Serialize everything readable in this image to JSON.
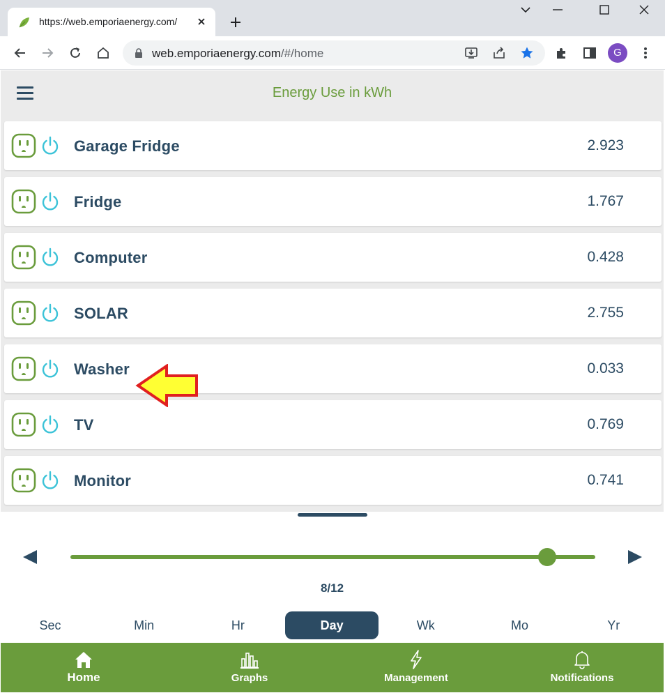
{
  "browser": {
    "tab_title": "https://web.emporiaenergy.com/",
    "url_host": "web.emporiaenergy.com",
    "url_path": "/#/home",
    "profile_initial": "G"
  },
  "app": {
    "title": "Energy Use in kWh",
    "devices": [
      {
        "name": "Garage Fridge",
        "value": "2.923"
      },
      {
        "name": "Fridge",
        "value": "1.767"
      },
      {
        "name": "Computer",
        "value": "0.428"
      },
      {
        "name": "SOLAR",
        "value": "2.755"
      },
      {
        "name": "Washer",
        "value": "0.033"
      },
      {
        "name": "TV",
        "value": "0.769"
      },
      {
        "name": "Monitor",
        "value": "0.741"
      }
    ],
    "date_label": "8/12",
    "slider_position": 0.908,
    "time_ranges": [
      "Sec",
      "Min",
      "Hr",
      "Day",
      "Wk",
      "Mo",
      "Yr"
    ],
    "active_range": "Day",
    "nav": [
      {
        "label": "Home",
        "icon": "home-icon"
      },
      {
        "label": "Graphs",
        "icon": "bar-chart-icon"
      },
      {
        "label": "Management",
        "icon": "lightning-icon"
      },
      {
        "label": "Notifications",
        "icon": "bell-icon"
      }
    ]
  },
  "colors": {
    "accent_green": "#6a9c3c",
    "navy": "#2c4b63",
    "power_cyan": "#3cc3d8",
    "arrow_yellow": "#ffff33",
    "arrow_red": "#e02020"
  }
}
